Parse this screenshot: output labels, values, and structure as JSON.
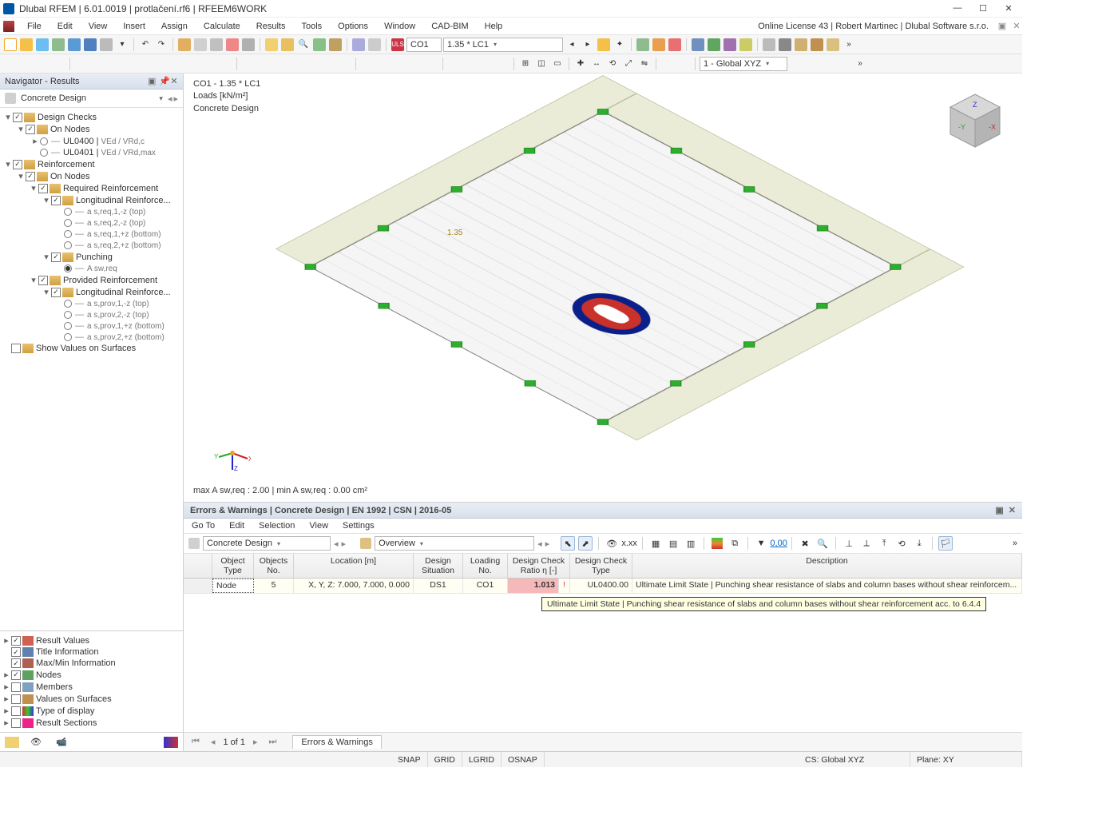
{
  "window": {
    "title": "Dlubal RFEM | 6.01.0019 | protlačení.rf6 | RFEEM6WORK"
  },
  "license": "Online License 43 | Robert Martinec | Dlubal Software s.r.o.",
  "menus": [
    "File",
    "Edit",
    "View",
    "Insert",
    "Assign",
    "Calculate",
    "Results",
    "Tools",
    "Options",
    "Window",
    "CAD-BIM",
    "Help"
  ],
  "toolbar1": {
    "uls_tag": "ULS",
    "combo_co": "CO1",
    "combo_lc": "1.35 * LC1",
    "coord_combo": "1 - Global XYZ"
  },
  "navigator": {
    "title": "Navigator - Results",
    "selector": "Concrete Design",
    "tree": {
      "design_checks": "Design Checks",
      "on_nodes1": "On Nodes",
      "ul0400": "UL0400 |",
      "ul0400_sub": "VEd / VRd,c",
      "ul0401": "UL0401 |",
      "ul0401_sub": "VEd / VRd,max",
      "reinforcement": "Reinforcement",
      "on_nodes2": "On Nodes",
      "req_reinf": "Required Reinforcement",
      "long_reinf1": "Longitudinal Reinforce...",
      "a1": "a s,req,1,-z (top)",
      "a2": "a s,req,2,-z (top)",
      "a3": "a s,req,1,+z (bottom)",
      "a4": "a s,req,2,+z (bottom)",
      "punching": "Punching",
      "aswreq": "A sw,req",
      "prov_reinf": "Provided Reinforcement",
      "long_reinf2": "Longitudinal Reinforce...",
      "b1": "a s,prov,1,-z (top)",
      "b2": "a s,prov,2,-z (top)",
      "b3": "a s,prov,1,+z (bottom)",
      "b4": "a s,prov,2,+z (bottom)",
      "show_vals": "Show Values on Surfaces"
    },
    "lower": [
      "Result Values",
      "Title Information",
      "Max/Min Information",
      "Nodes",
      "Members",
      "Values on Surfaces",
      "Type of display",
      "Result Sections"
    ]
  },
  "viewport": {
    "line1": "CO1 - 1.35 * LC1",
    "line2": "Loads [kN/m²]",
    "line3": "Concrete Design",
    "load_factor": "1.35",
    "stats": "max A sw,req : 2.00 | min A sw,req : 0.00 cm²"
  },
  "errors_panel": {
    "title": "Errors & Warnings | Concrete Design | EN 1992 | CSN | 2016-05",
    "menus": [
      "Go To",
      "Edit",
      "Selection",
      "View",
      "Settings"
    ],
    "combo1": "Concrete Design",
    "combo2": "Overview",
    "headers": [
      "Object Type",
      "Objects No.",
      "Location [m]",
      "Design Situation",
      "Loading No.",
      "Design Check Ratio η [-]",
      "Design Check Type",
      "Description"
    ],
    "row": {
      "obj_type": "Node",
      "obj_no": "5",
      "location": "X, Y, Z: 7.000, 7.000, 0.000",
      "ds": "DS1",
      "loading": "CO1",
      "ratio": "1.013",
      "check_type": "UL0400.00",
      "desc": "Ultimate Limit State | Punching shear resistance of slabs and column bases without shear reinforcem..."
    },
    "tooltip": "Ultimate Limit State | Punching shear resistance of slabs and column bases without shear reinforcement acc. to 6.4.4",
    "pager_text": "1 of 1",
    "tab": "Errors & Warnings"
  },
  "statusbar": {
    "items": [
      "SNAP",
      "GRID",
      "LGRID",
      "OSNAP"
    ],
    "cs": "CS: Global XYZ",
    "plane": "Plane: XY"
  }
}
